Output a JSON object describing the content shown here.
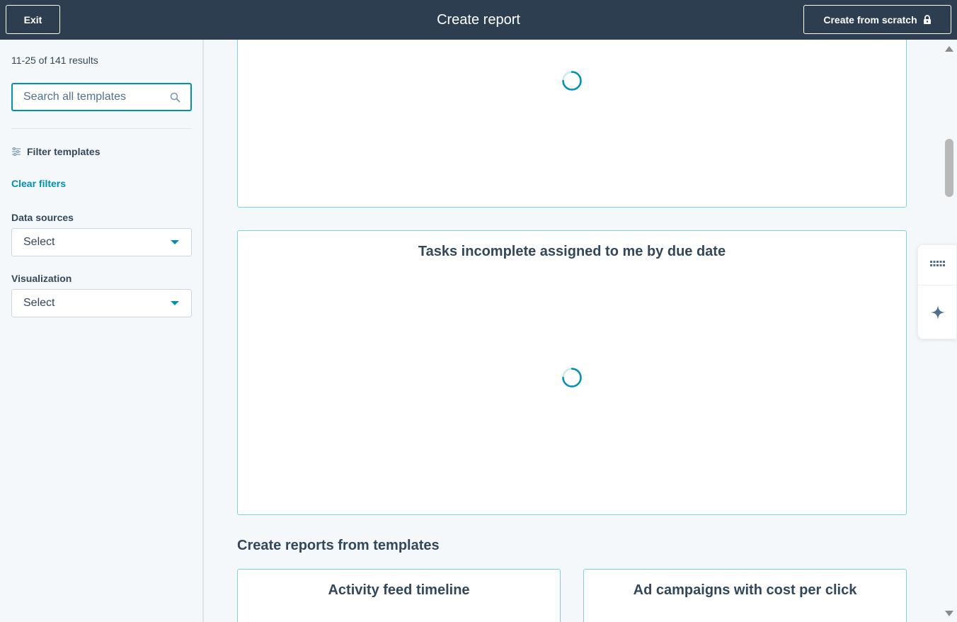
{
  "header": {
    "exit_label": "Exit",
    "title": "Create report",
    "create_from_scratch_label": "Create from scratch",
    "lock_icon": "lock-icon"
  },
  "sidebar": {
    "results_count": "11-25 of 141 results",
    "search": {
      "placeholder": "Search all templates",
      "value": "",
      "icon": "search-icon"
    },
    "filter_templates_label": "Filter templates",
    "filter_icon": "sliders-icon",
    "clear_filters_label": "Clear filters",
    "data_sources": {
      "label": "Data sources",
      "selected": "Select"
    },
    "visualization": {
      "label": "Visualization",
      "selected": "Select"
    }
  },
  "main": {
    "cards": [
      {
        "title": "",
        "state": "loading"
      },
      {
        "title": "Tasks incomplete assigned to me by due date",
        "state": "loading"
      }
    ],
    "section_heading": "Create reports from templates",
    "template_cards": [
      {
        "title": "Activity feed timeline"
      },
      {
        "title": "Ad campaigns with cost per click"
      }
    ]
  },
  "side_widget": {
    "icons": [
      "grid-icon",
      "sparkle-icon"
    ]
  },
  "colors": {
    "header_bg": "#2d3e50",
    "accent": "#0091ae",
    "card_border": "#7fd1de",
    "page_bg": "#f5f8fa",
    "text": "#33475b",
    "ai_sparkle": "#4f6f8f"
  }
}
